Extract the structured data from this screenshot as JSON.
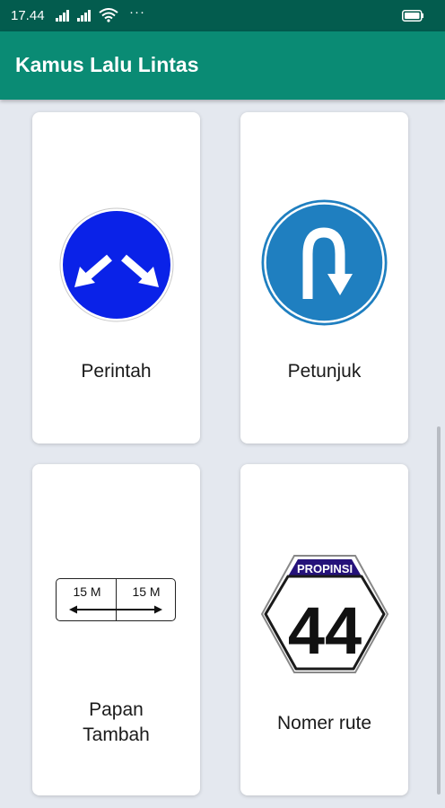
{
  "status_bar": {
    "time": "17.44",
    "dots": "···"
  },
  "app_bar": {
    "title": "Kamus Lalu Lintas"
  },
  "categories": [
    {
      "label": "Perintah",
      "icon": "blue-mandatory-sign-icon"
    },
    {
      "label": "Petunjuk",
      "icon": "u-turn-sign-icon"
    },
    {
      "label": "Papan\nTambah",
      "icon": "additional-plate-sign-icon"
    },
    {
      "label": "Nomer rute",
      "icon": "route-number-sign-icon"
    }
  ],
  "signs": {
    "plate_left": "15 M",
    "plate_right": "15 M",
    "route_header": "PROPINSI",
    "route_number": "44"
  },
  "colors": {
    "status_bar": "#035c4e",
    "app_bar": "#0a8b74",
    "background": "#e4e8ef",
    "mandatory_blue": "#0a22e8",
    "guide_blue": "#1f7fc0",
    "route_header": "#25127a"
  }
}
